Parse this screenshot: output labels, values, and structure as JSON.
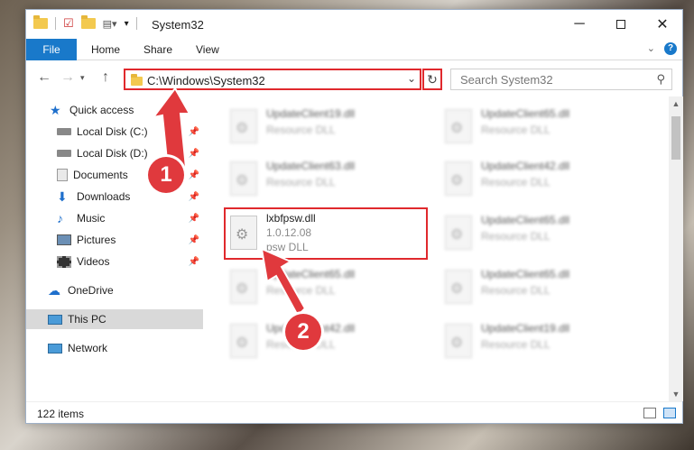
{
  "window": {
    "title": "System32",
    "minimize_icon": "minimize-icon",
    "maximize_icon": "maximize-icon",
    "close_icon": "close-icon"
  },
  "ribbon": {
    "tabs": [
      "File",
      "Home",
      "Share",
      "View"
    ],
    "help": "?"
  },
  "address": {
    "path": "C:\\Windows\\System32",
    "search_placeholder": "Search System32"
  },
  "sidebar": {
    "items": [
      {
        "label": "Quick access",
        "icon": "star-icon",
        "pinned": false
      },
      {
        "label": "Local Disk (C:)",
        "icon": "drive-icon",
        "pinned": true
      },
      {
        "label": "Local Disk (D:)",
        "icon": "drive-icon",
        "pinned": true
      },
      {
        "label": "Documents",
        "icon": "documents-icon",
        "pinned": true
      },
      {
        "label": "Downloads",
        "icon": "download-icon",
        "pinned": true
      },
      {
        "label": "Music",
        "icon": "music-icon",
        "pinned": true
      },
      {
        "label": "Pictures",
        "icon": "pictures-icon",
        "pinned": true
      },
      {
        "label": "Videos",
        "icon": "videos-icon",
        "pinned": true
      },
      {
        "label": "OneDrive",
        "icon": "cloud-icon",
        "pinned": false
      },
      {
        "label": "This PC",
        "icon": "computer-icon",
        "pinned": false,
        "selected": true
      },
      {
        "label": "Network",
        "icon": "network-icon",
        "pinned": false
      }
    ]
  },
  "files": [
    {
      "name": "UpdateClient19.dll",
      "sub": "Resource DLL"
    },
    {
      "name": "UpdateClient65.dll",
      "sub": "Resource DLL"
    },
    {
      "name": "UpdateClient63.dll",
      "sub": "Resource DLL"
    },
    {
      "name": "UpdateClient42.dll",
      "sub": "Resource DLL"
    },
    {
      "name": "lxbfpsw.dll",
      "version": "1.0.12.08",
      "sub": "psw DLL"
    },
    {
      "name": "UpdateClient65.dll",
      "sub": "Resource DLL"
    },
    {
      "name": "UpdateClient65.dll",
      "sub": "Resource DLL"
    },
    {
      "name": "UpdateClient65.dll",
      "sub": "Resource DLL"
    },
    {
      "name": "UpdateClient42.dll",
      "sub": "Resource DLL"
    },
    {
      "name": "UpdateClient19.dll",
      "sub": "Resource DLL"
    }
  ],
  "status": {
    "item_count": "122 items"
  },
  "annotations": {
    "step1": "1",
    "step2": "2",
    "color": "#e0393d"
  },
  "colors": {
    "accent": "#1979ca",
    "highlight": "#e0292d"
  }
}
